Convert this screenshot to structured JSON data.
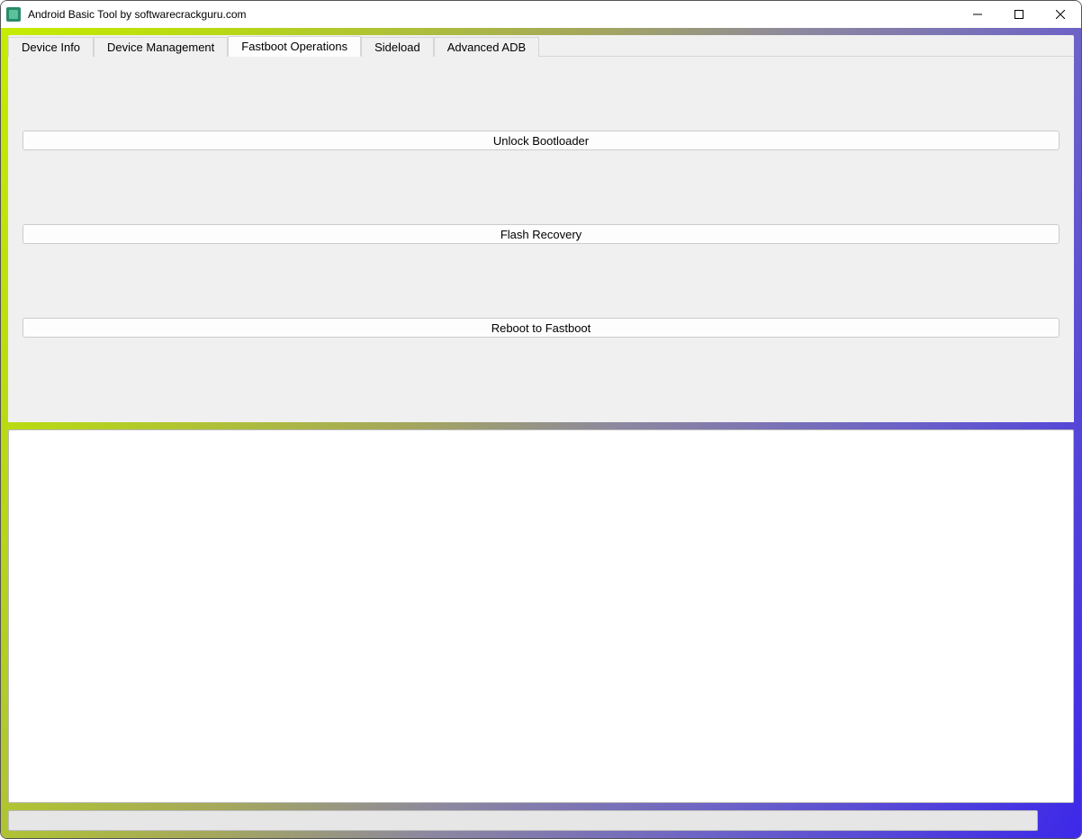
{
  "window": {
    "title": "Android Basic Tool by softwarecrackguru.com"
  },
  "tabs": [
    {
      "label": "Device Info"
    },
    {
      "label": "Device Management"
    },
    {
      "label": "Fastboot Operations"
    },
    {
      "label": "Sideload"
    },
    {
      "label": "Advanced ADB"
    }
  ],
  "activeTabIndex": 2,
  "fastboot": {
    "buttons": [
      {
        "label": "Unlock Bootloader"
      },
      {
        "label": "Flash Recovery"
      },
      {
        "label": "Reboot to Fastboot"
      }
    ]
  },
  "statusText": ""
}
